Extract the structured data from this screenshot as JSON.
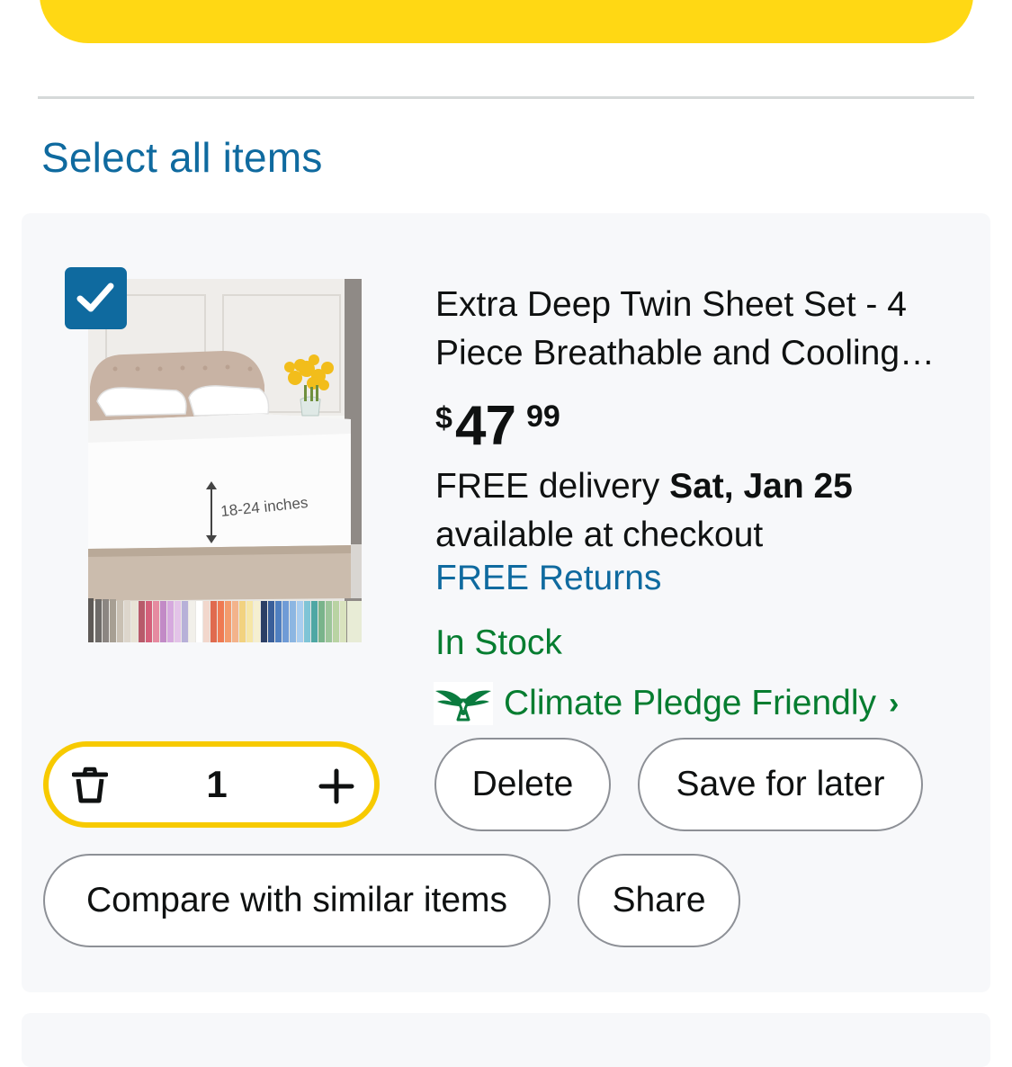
{
  "select_all": "Select all items",
  "product": {
    "title": "Extra Deep Twin Sheet Set - 4 Piece Breathable and Cooling Sheets",
    "image_label": "18-24 inches",
    "price": {
      "symbol": "$",
      "whole": "47",
      "fraction": "99"
    },
    "delivery_prefix": "FREE delivery ",
    "delivery_date": "Sat, Jan 25",
    "delivery_suffix": "available at checkout",
    "returns": "FREE Returns",
    "stock": "In Stock",
    "climate_pledge": "Climate Pledge Friendly",
    "climate_chevron": "›",
    "selected": true
  },
  "quantity": {
    "value": "1",
    "decrease_icon": "trash-icon",
    "increase_icon": "plus-icon"
  },
  "actions": {
    "delete": "Delete",
    "save_for_later": "Save for later",
    "compare": "Compare with similar items",
    "share": "Share"
  },
  "colors": {
    "link": "#0f6a9f",
    "in_stock": "#067d30",
    "checkout_yellow": "#ffd814",
    "qty_border": "#f7ca00",
    "card_bg": "#f7f8fa"
  }
}
